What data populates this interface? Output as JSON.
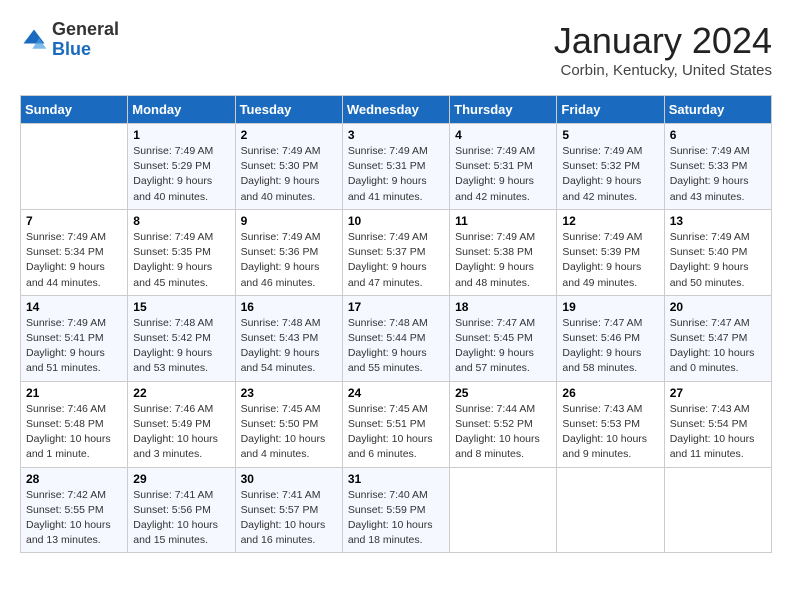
{
  "header": {
    "logo_general": "General",
    "logo_blue": "Blue",
    "month": "January 2024",
    "location": "Corbin, Kentucky, United States"
  },
  "days_of_week": [
    "Sunday",
    "Monday",
    "Tuesday",
    "Wednesday",
    "Thursday",
    "Friday",
    "Saturday"
  ],
  "weeks": [
    [
      {
        "day": "",
        "info": ""
      },
      {
        "day": "1",
        "info": "Sunrise: 7:49 AM\nSunset: 5:29 PM\nDaylight: 9 hours\nand 40 minutes."
      },
      {
        "day": "2",
        "info": "Sunrise: 7:49 AM\nSunset: 5:30 PM\nDaylight: 9 hours\nand 40 minutes."
      },
      {
        "day": "3",
        "info": "Sunrise: 7:49 AM\nSunset: 5:31 PM\nDaylight: 9 hours\nand 41 minutes."
      },
      {
        "day": "4",
        "info": "Sunrise: 7:49 AM\nSunset: 5:31 PM\nDaylight: 9 hours\nand 42 minutes."
      },
      {
        "day": "5",
        "info": "Sunrise: 7:49 AM\nSunset: 5:32 PM\nDaylight: 9 hours\nand 42 minutes."
      },
      {
        "day": "6",
        "info": "Sunrise: 7:49 AM\nSunset: 5:33 PM\nDaylight: 9 hours\nand 43 minutes."
      }
    ],
    [
      {
        "day": "7",
        "info": "Sunrise: 7:49 AM\nSunset: 5:34 PM\nDaylight: 9 hours\nand 44 minutes."
      },
      {
        "day": "8",
        "info": "Sunrise: 7:49 AM\nSunset: 5:35 PM\nDaylight: 9 hours\nand 45 minutes."
      },
      {
        "day": "9",
        "info": "Sunrise: 7:49 AM\nSunset: 5:36 PM\nDaylight: 9 hours\nand 46 minutes."
      },
      {
        "day": "10",
        "info": "Sunrise: 7:49 AM\nSunset: 5:37 PM\nDaylight: 9 hours\nand 47 minutes."
      },
      {
        "day": "11",
        "info": "Sunrise: 7:49 AM\nSunset: 5:38 PM\nDaylight: 9 hours\nand 48 minutes."
      },
      {
        "day": "12",
        "info": "Sunrise: 7:49 AM\nSunset: 5:39 PM\nDaylight: 9 hours\nand 49 minutes."
      },
      {
        "day": "13",
        "info": "Sunrise: 7:49 AM\nSunset: 5:40 PM\nDaylight: 9 hours\nand 50 minutes."
      }
    ],
    [
      {
        "day": "14",
        "info": "Sunrise: 7:49 AM\nSunset: 5:41 PM\nDaylight: 9 hours\nand 51 minutes."
      },
      {
        "day": "15",
        "info": "Sunrise: 7:48 AM\nSunset: 5:42 PM\nDaylight: 9 hours\nand 53 minutes."
      },
      {
        "day": "16",
        "info": "Sunrise: 7:48 AM\nSunset: 5:43 PM\nDaylight: 9 hours\nand 54 minutes."
      },
      {
        "day": "17",
        "info": "Sunrise: 7:48 AM\nSunset: 5:44 PM\nDaylight: 9 hours\nand 55 minutes."
      },
      {
        "day": "18",
        "info": "Sunrise: 7:47 AM\nSunset: 5:45 PM\nDaylight: 9 hours\nand 57 minutes."
      },
      {
        "day": "19",
        "info": "Sunrise: 7:47 AM\nSunset: 5:46 PM\nDaylight: 9 hours\nand 58 minutes."
      },
      {
        "day": "20",
        "info": "Sunrise: 7:47 AM\nSunset: 5:47 PM\nDaylight: 10 hours\nand 0 minutes."
      }
    ],
    [
      {
        "day": "21",
        "info": "Sunrise: 7:46 AM\nSunset: 5:48 PM\nDaylight: 10 hours\nand 1 minute."
      },
      {
        "day": "22",
        "info": "Sunrise: 7:46 AM\nSunset: 5:49 PM\nDaylight: 10 hours\nand 3 minutes."
      },
      {
        "day": "23",
        "info": "Sunrise: 7:45 AM\nSunset: 5:50 PM\nDaylight: 10 hours\nand 4 minutes."
      },
      {
        "day": "24",
        "info": "Sunrise: 7:45 AM\nSunset: 5:51 PM\nDaylight: 10 hours\nand 6 minutes."
      },
      {
        "day": "25",
        "info": "Sunrise: 7:44 AM\nSunset: 5:52 PM\nDaylight: 10 hours\nand 8 minutes."
      },
      {
        "day": "26",
        "info": "Sunrise: 7:43 AM\nSunset: 5:53 PM\nDaylight: 10 hours\nand 9 minutes."
      },
      {
        "day": "27",
        "info": "Sunrise: 7:43 AM\nSunset: 5:54 PM\nDaylight: 10 hours\nand 11 minutes."
      }
    ],
    [
      {
        "day": "28",
        "info": "Sunrise: 7:42 AM\nSunset: 5:55 PM\nDaylight: 10 hours\nand 13 minutes."
      },
      {
        "day": "29",
        "info": "Sunrise: 7:41 AM\nSunset: 5:56 PM\nDaylight: 10 hours\nand 15 minutes."
      },
      {
        "day": "30",
        "info": "Sunrise: 7:41 AM\nSunset: 5:57 PM\nDaylight: 10 hours\nand 16 minutes."
      },
      {
        "day": "31",
        "info": "Sunrise: 7:40 AM\nSunset: 5:59 PM\nDaylight: 10 hours\nand 18 minutes."
      },
      {
        "day": "",
        "info": ""
      },
      {
        "day": "",
        "info": ""
      },
      {
        "day": "",
        "info": ""
      }
    ]
  ]
}
